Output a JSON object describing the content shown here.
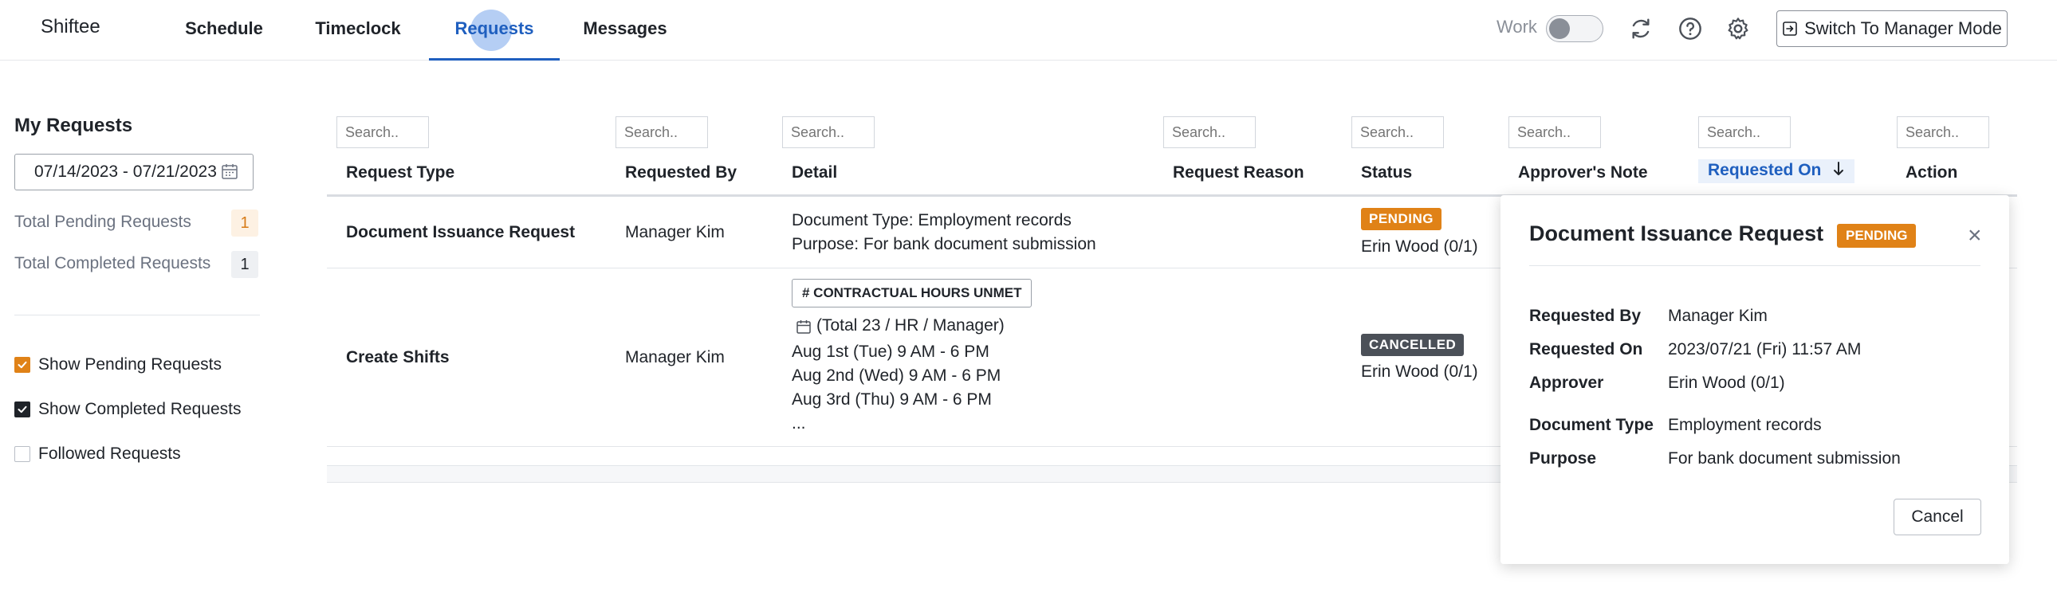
{
  "app": {
    "brand": "Shiftee"
  },
  "nav": {
    "tabs": [
      {
        "label": "Schedule"
      },
      {
        "label": "Timeclock"
      },
      {
        "label": "Requests"
      },
      {
        "label": "Messages"
      }
    ],
    "work_label": "Work",
    "icons": [
      "refresh-icon",
      "help-icon",
      "gear-icon"
    ],
    "manager_button": "Switch To Manager Mode"
  },
  "sidebar": {
    "title": "My Requests",
    "date_range": "07/14/2023 - 07/21/2023",
    "stats": [
      {
        "label": "Total Pending Requests",
        "count": "1"
      },
      {
        "label": "Total Completed Requests",
        "count": "1"
      }
    ],
    "filters": [
      {
        "label": "Show Pending Requests",
        "checked": true
      },
      {
        "label": "Show Completed Requests",
        "checked": true
      },
      {
        "label": "Followed Requests",
        "checked": false
      }
    ]
  },
  "table": {
    "search_placeholder": "Search..",
    "columns": [
      "Request Type",
      "Requested By",
      "Detail",
      "Request Reason",
      "Status",
      "Approver's Note",
      "Requested On",
      "Action"
    ],
    "rows": [
      {
        "type": "Document Issuance Request",
        "requested_by": "Manager Kim",
        "detail": [
          "Document Type: Employment records",
          "Purpose: For bank document submission"
        ],
        "status": "PENDING",
        "approver": "Erin Wood (0/1)"
      },
      {
        "type": "Create Shifts",
        "requested_by": "Manager Kim",
        "tag": "# CONTRACTUAL HOURS UNMET",
        "summary": "(Total 23 / HR / Manager)",
        "detail": [
          "Aug 1st (Tue) 9 AM - 6 PM",
          "Aug 2nd (Wed) 9 AM - 6 PM",
          "Aug 3rd (Thu) 9 AM - 6 PM",
          "..."
        ],
        "status": "CANCELLED",
        "approver": "Erin Wood (0/1)"
      }
    ]
  },
  "popup": {
    "title": "Document Issuance Request",
    "status": "PENDING",
    "fields": [
      {
        "label": "Requested By",
        "value": "Manager Kim"
      },
      {
        "label": "Requested On",
        "value": "2023/07/21 (Fri) 11:57 AM"
      },
      {
        "label": "Approver",
        "value": "Erin Wood (0/1)"
      },
      {
        "label": "Document Type",
        "value": "Employment records"
      },
      {
        "label": "Purpose",
        "value": "For bank document submission"
      }
    ],
    "cancel_label": "Cancel"
  },
  "colors": {
    "accent": "#1f5fbf",
    "pending": "#e08217",
    "cancelled": "#4b5058"
  }
}
